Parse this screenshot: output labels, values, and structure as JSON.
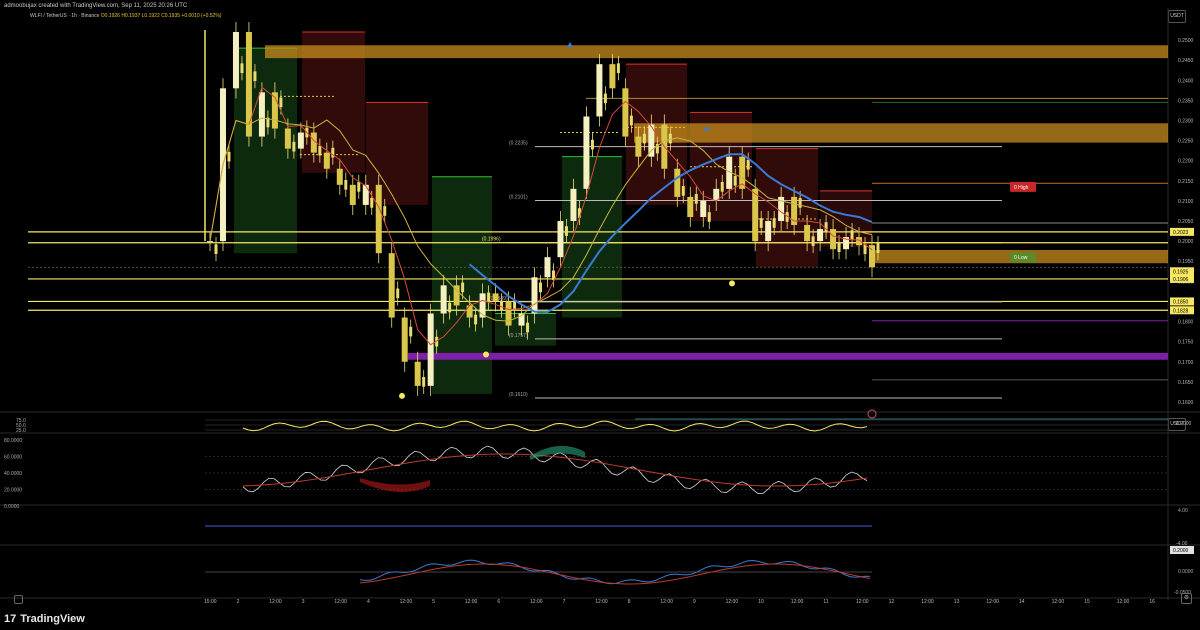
{
  "header": {
    "credit": "admoobujax created with TradingView.com, Sep 11, 2025 20:26 UTC",
    "symbol": "WLFI / TetherUS · 1h · Binance",
    "ohlc": "O0.1926 H0.1937 L0.1922 C0.1935 +0.0010 (+0.52%)",
    "currency": "USDT"
  },
  "footer": {
    "brand": "TradingView",
    "brand_mark": "17"
  },
  "colors": {
    "background": "#000000",
    "ema_blue": "#3a7bd5",
    "sma_yellow": "#c9b43c",
    "ema_red": "#d44a3a",
    "level_yellow": "#f5e663",
    "level_purple": "#7e1fa8",
    "supply_orange": "#c88a1e",
    "candle": "#f0e27a"
  },
  "price_axis": {
    "labels": [
      "0.2500",
      "0.2450",
      "0.2400",
      "0.2350",
      "0.2300",
      "0.2250",
      "0.2200",
      "0.2150",
      "0.2100",
      "0.2050",
      "0.2000",
      "0.1950",
      "0.1900",
      "0.1850",
      "0.1800",
      "0.1750",
      "0.1700",
      "0.1650",
      "0.1600"
    ],
    "badges": [
      {
        "text": "0.2023",
        "kind": "yellow"
      },
      {
        "text": "0.1925",
        "kind": "yellow"
      },
      {
        "text": "0.1906",
        "kind": "yellow"
      },
      {
        "text": "0.1850",
        "kind": "yellow"
      },
      {
        "text": "0.1828",
        "kind": "yellow"
      }
    ],
    "high_tag": "0 High",
    "low_tag": "0 Low"
  },
  "time_axis": {
    "labels": [
      "15:00",
      "2",
      "12:00",
      "3",
      "12:00",
      "4",
      "12:00",
      "5",
      "12:00",
      "6",
      "12:00",
      "7",
      "12:00",
      "8",
      "12:00",
      "9",
      "12:00",
      "10",
      "12:00",
      "11",
      "12:00",
      "12",
      "12:00",
      "13",
      "12:00",
      "14",
      "12:00",
      "15",
      "12:00",
      "16"
    ]
  },
  "fib_labels": [
    "(0.2235)",
    "(0.2101)",
    "(0.1996)",
    "(0.1849)",
    "(0.1757)",
    "(0.1610)"
  ],
  "indicators": {
    "rsi_axis": [
      "75.0",
      "50.0",
      "25.0"
    ],
    "rsi_value": "0.2000",
    "osc_axis": [
      "80.0000",
      "60.0000",
      "40.0000",
      "20.0000",
      "0.0000"
    ],
    "macd_axis": [
      "4.00",
      "-4.00"
    ],
    "macd_tag": "0.2000",
    "mom_axis": [
      "0.0000",
      "-0.0500"
    ]
  },
  "chart_data": {
    "type": "candlestick",
    "title": "WLFI / TetherUS · 1h · Binance",
    "ylim": [
      0.1585,
      0.2525
    ],
    "x": [
      "15:00",
      "2",
      "12:00",
      "3",
      "12:00",
      "4",
      "12:00",
      "5",
      "12:00",
      "6",
      "12:00",
      "7",
      "12:00",
      "8",
      "12:00",
      "9",
      "12:00",
      "10",
      "12:00",
      "11",
      "12:00"
    ],
    "close_path": [
      0.2,
      0.238,
      0.252,
      0.226,
      0.237,
      0.228,
      0.223,
      0.227,
      0.222,
      0.218,
      0.214,
      0.209,
      0.214,
      0.197,
      0.181,
      0.17,
      0.164,
      0.182,
      0.189,
      0.184,
      0.181,
      0.187,
      0.185,
      0.179,
      0.182,
      0.191,
      0.196,
      0.205,
      0.213,
      0.231,
      0.244,
      0.238,
      0.226,
      0.221,
      0.229,
      0.218,
      0.211,
      0.206,
      0.21,
      0.213,
      0.221,
      0.213,
      0.2,
      0.205,
      0.211,
      0.204,
      0.2,
      0.203,
      0.198,
      0.201,
      0.199,
      0.1935
    ],
    "horizontal_levels": [
      0.2023,
      0.1996,
      0.1906,
      0.185,
      0.1828
    ],
    "fib_levels": [
      0.2235,
      0.2101,
      0.1996,
      0.1849,
      0.1757,
      0.161
    ]
  }
}
